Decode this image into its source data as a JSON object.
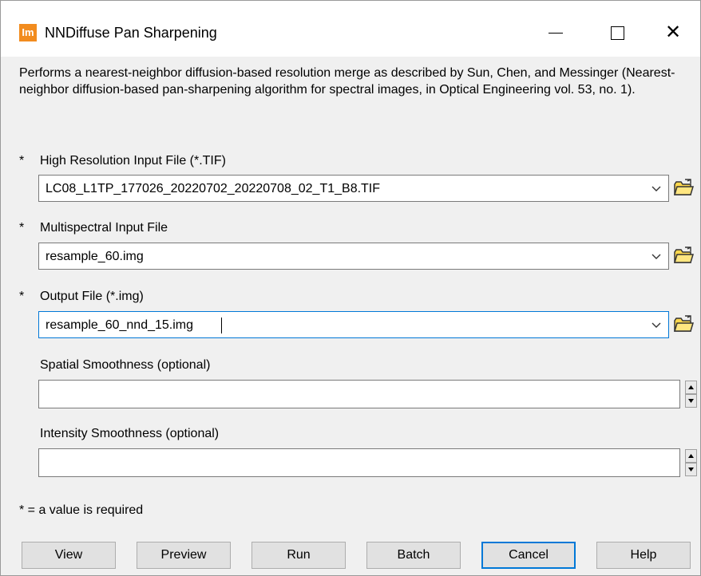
{
  "window": {
    "app_icon_text": "Im",
    "title": "NNDiffuse Pan Sharpening",
    "minimize_label": "",
    "maximize_label": "",
    "close_label": "✕"
  },
  "description": "Performs a nearest-neighbor diffusion-based resolution merge as described by Sun, Chen, and Messinger (Nearest-neighbor diffusion-based pan-sharpening algorithm for spectral images, in Optical Engineering vol. 53, no. 1).",
  "fields": {
    "high_res": {
      "required_mark": "*",
      "label": "High Resolution Input File (*.TIF)",
      "value": "LC08_L1TP_177026_20220702_20220708_02_T1_B8.TIF"
    },
    "multispectral": {
      "required_mark": "*",
      "label": "Multispectral Input File",
      "value": "resample_60.img"
    },
    "output": {
      "required_mark": "*",
      "label": "Output File (*.img)",
      "value": "resample_60_nnd_15.img"
    },
    "spatial": {
      "label": "Spatial Smoothness (optional)",
      "value": ""
    },
    "intensity": {
      "label": "Intensity Smoothness (optional)",
      "value": ""
    }
  },
  "footnote": "* = a value is required",
  "buttons": {
    "view": "View",
    "preview": "Preview",
    "run": "Run",
    "batch": "Batch",
    "cancel": "Cancel",
    "help": "Help"
  },
  "colors": {
    "app_icon": "#f28c1f",
    "focus_border": "#0078d7",
    "folder_fill": "#ffd84d"
  }
}
